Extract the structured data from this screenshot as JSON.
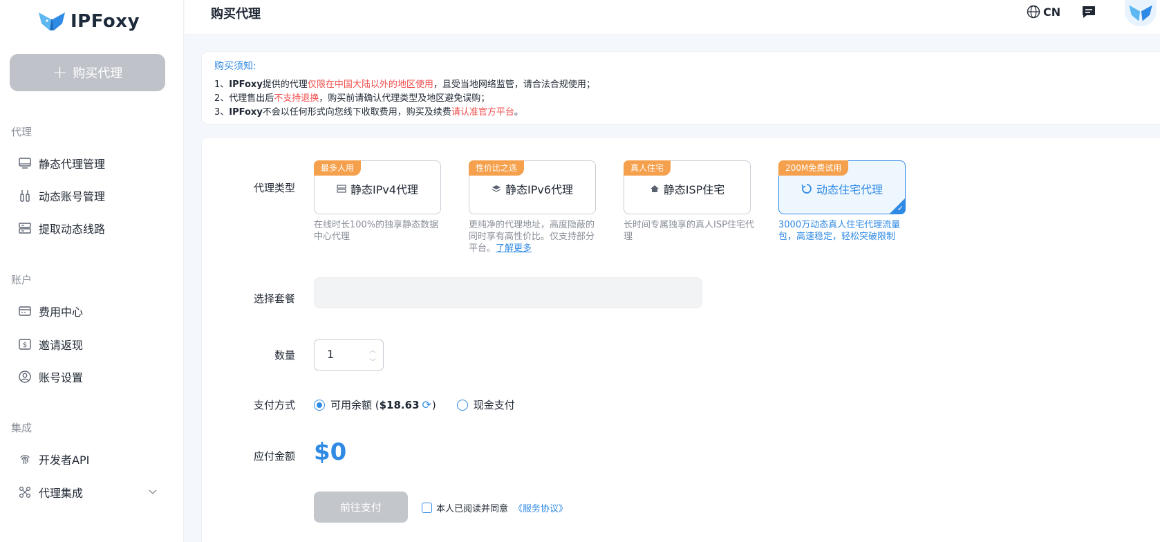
{
  "brand": {
    "name": "IPFoxy"
  },
  "sidebar": {
    "buy_button": "购买代理",
    "sections": [
      {
        "title": "代理",
        "items": [
          "静态代理管理",
          "动态账号管理",
          "提取动态线路"
        ]
      },
      {
        "title": "账户",
        "items": [
          "费用中心",
          "邀请返现",
          "账号设置"
        ]
      },
      {
        "title": "集成",
        "items": [
          "开发者API",
          "代理集成"
        ]
      }
    ]
  },
  "header": {
    "title": "购买代理",
    "lang": "CN"
  },
  "notice": {
    "title": "购买须知:",
    "line1": {
      "a": "1、",
      "b": "IPFoxy",
      "c": "提供的代理",
      "d": "仅限在中国大陆以外的地区使用",
      "e": "，且受当地网络监管，请合法合规使用；"
    },
    "line2": {
      "a": "2、代理售出后",
      "b": "不支持退换",
      "c": "，购买前请确认代理类型及地区避免误购；"
    },
    "line3": {
      "a": "3、",
      "b": "IPFoxy",
      "c": "不会以任何形式向您线下收取费用，购买及续费",
      "d": "请认准官方平台",
      "e": "。"
    }
  },
  "form": {
    "labels": {
      "type": "代理类型",
      "package": "选择套餐",
      "quantity": "数量",
      "payment": "支付方式",
      "amount": "应付金额"
    },
    "proxy_types": [
      {
        "tag": "最多人用",
        "title": "静态IPv4代理",
        "desc": "在线时长100%的独享静态数据中心代理",
        "active": false
      },
      {
        "tag": "性价比之选",
        "title": "静态IPv6代理",
        "desc": "更纯净的代理地址，高度隐蔽的同时享有高性价比。仅支持部分平台。",
        "link": "了解更多",
        "active": false
      },
      {
        "tag": "真人住宅",
        "title": "静态ISP住宅",
        "desc": "长时间专属独享的真人ISP住宅代理",
        "active": false
      },
      {
        "tag": "200M免费试用",
        "title": "动态住宅代理",
        "desc": "3000万动态真人住宅代理流量包，高速稳定，轻松突破限制",
        "active": true
      }
    ],
    "quantity": "1",
    "payment": {
      "balance_label": "可用余额 (",
      "balance_value": "$18.63",
      "balance_close": ")",
      "cash_label": "现金支付"
    },
    "amount": "$0",
    "pay_button": "前往支付",
    "agree_text": "本人已阅读并同意",
    "tos": "《服务协议》"
  },
  "colors": {
    "accent": "#2f8ae5",
    "tag": "#f5a04c",
    "warning": "#f04d4d"
  }
}
